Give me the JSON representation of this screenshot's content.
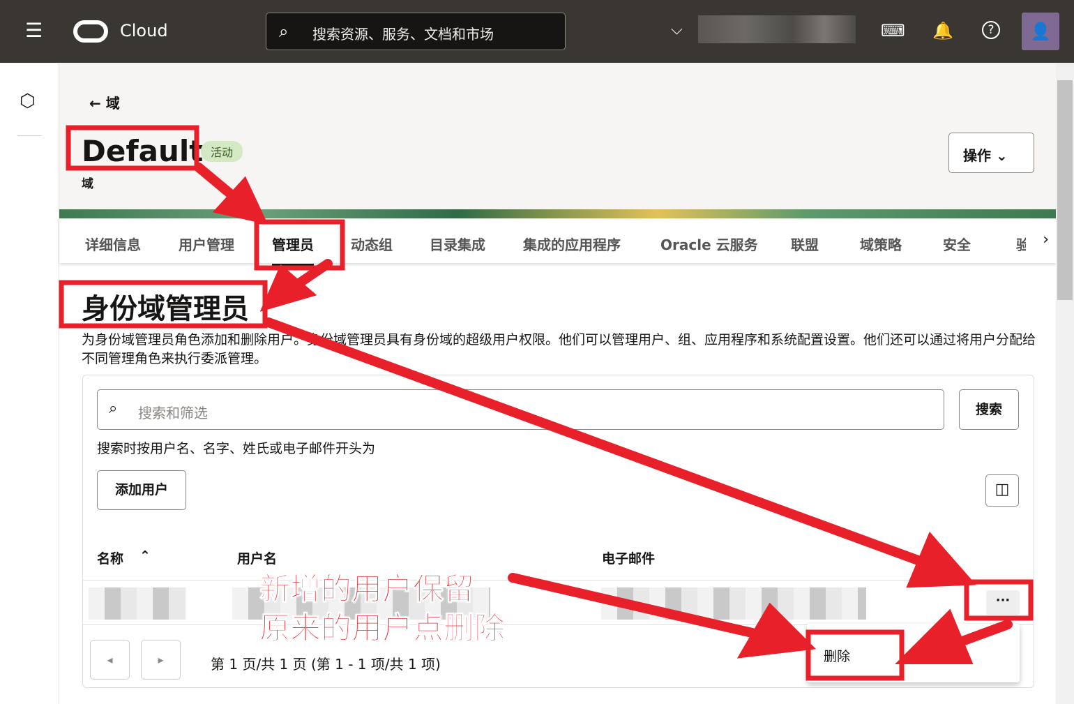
{
  "topbar": {
    "app": "Cloud",
    "search_placeholder": "搜索资源、服务、文档和市场",
    "menu_icon": "☰",
    "search_icon": "⌕",
    "chevron": "⌵",
    "dev_icon": "⌨",
    "bell_icon": "🔔",
    "help_icon": "?",
    "avatar_icon": "👤"
  },
  "header": {
    "back_label": "← 域",
    "title": "Default",
    "status": "活动",
    "subtitle": "域",
    "actions": "操作 ⌄"
  },
  "tabs": [
    "详细信息",
    "用户管理",
    "管理员",
    "动态组",
    "目录集成",
    "集成的应用程序",
    "Oracle 云服务",
    "联盟",
    "域策略",
    "安全",
    "验"
  ],
  "active_tab": "管理员",
  "section": {
    "title": "身份域管理员",
    "description": "为身份域管理员角色添加和删除用户。身份域管理员具有身份域的超级用户权限。他们可以管理用户、组、应用程序和系统配置设置。他们还可以通过将用户分配给不同管理角色来执行委派管理。"
  },
  "search": {
    "placeholder": "搜索和筛选",
    "button": "搜索",
    "hint": "搜索时按用户名、名字、姓氏或电子邮件开头为"
  },
  "add_user": "添加用户",
  "table": {
    "columns": [
      "名称",
      "用户名",
      "电子邮件"
    ],
    "sort_icon": "⌃",
    "more": "···"
  },
  "pagination": "第 1 页/共 1 页 (第 1 - 1 项/共 1 项)",
  "menu": {
    "delete": "删除"
  },
  "annotations": {
    "line1": "新增的用户保留",
    "line2": "原来的用户点删除"
  },
  "colors": {
    "annotation": "#e8202a",
    "topbar": "#3a3733"
  }
}
